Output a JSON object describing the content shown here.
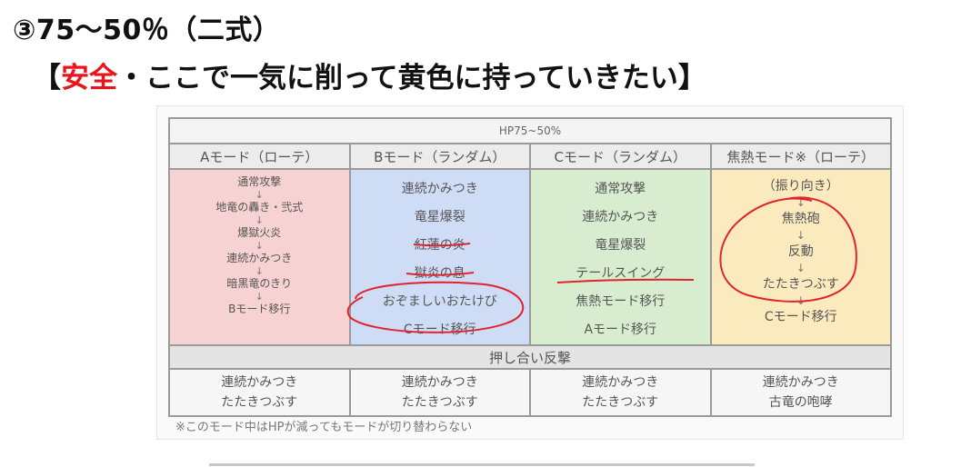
{
  "heading": "③75〜50％（二式）",
  "subheading": {
    "open": "【",
    "red": "安全",
    "rest": "・ここで一気に削って黄色に持っていきたい】"
  },
  "table": {
    "title": "HP75~50%",
    "columns": [
      "Aモード（ローテ）",
      "Bモード（ランダム）",
      "Cモード（ランダム）",
      "焦熱モード※（ローテ）"
    ],
    "col_a": [
      "通常攻撃",
      "地竜の轟き・弐式",
      "爆獄火炎",
      "連続かみつき",
      "暗黒竜のきり",
      "Bモード移行"
    ],
    "col_b": [
      "連続かみつき",
      "竜星爆裂",
      "紅蓮の炎",
      "獄炎の息",
      "おぞましいおたけび",
      "Cモード移行"
    ],
    "col_c": [
      "通常攻撃",
      "連続かみつき",
      "竜星爆裂",
      "テールスイング",
      "焦熱モード移行",
      "Aモード移行"
    ],
    "col_d": [
      "（振り向き）",
      "焦熱砲",
      "反動",
      "たたきつぶす",
      "Cモード移行"
    ],
    "arrow": "↓",
    "counter_title": "押し合い反撃",
    "counter": [
      [
        "連続かみつき",
        "たたきつぶす"
      ],
      [
        "連続かみつき",
        "たたきつぶす"
      ],
      [
        "連続かみつき",
        "たたきつぶす"
      ],
      [
        "連続かみつき",
        "古竜の咆哮"
      ]
    ],
    "note": "※このモード中はHPが減ってもモードが切り替わらない"
  },
  "colors": {
    "highlight_red": "#e8161b",
    "col_a_bg": "#f7d2d3",
    "col_b_bg": "#cfdcf6",
    "col_c_bg": "#d8edcf",
    "col_d_bg": "#fbeabe",
    "annotation": "#e0242e"
  }
}
